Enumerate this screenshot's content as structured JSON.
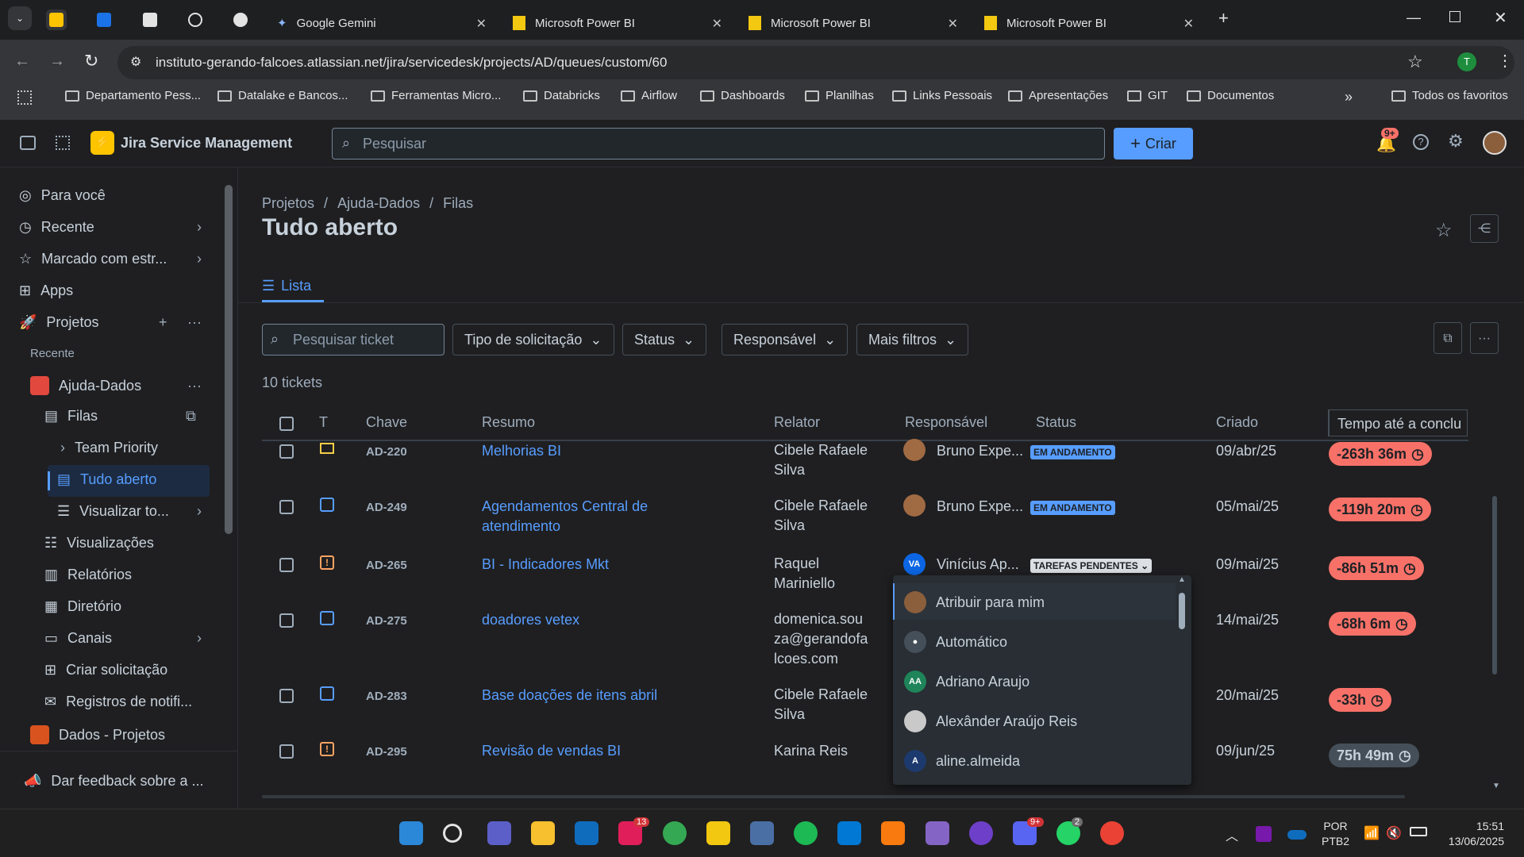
{
  "browser": {
    "tabs": [
      {
        "label": "Google Gemini"
      },
      {
        "label": "Microsoft Power BI"
      },
      {
        "label": "Microsoft Power BI"
      },
      {
        "label": "Microsoft Power BI"
      }
    ],
    "url": "instituto-gerando-falcoes.atlassian.net/jira/servicedesk/projects/AD/queues/custom/60",
    "profile_initial": "T",
    "bookmarks": [
      "Departamento Pess...",
      "Datalake e Bancos...",
      "Ferramentas Micro...",
      "Databricks",
      "Airflow",
      "Dashboards",
      "Planilhas",
      "Links Pessoais",
      "Apresentações",
      "GIT",
      "Documentos"
    ],
    "all_bookmarks": "Todos os favoritos",
    "more_bookmarks": "»"
  },
  "jira": {
    "product": "Jira Service Management",
    "search_placeholder": "Pesquisar",
    "create_label": "Criar",
    "notif_badge": "9+"
  },
  "sidebar": {
    "items": [
      {
        "label": "Para você"
      },
      {
        "label": "Recente"
      },
      {
        "label": "Marcado com estr..."
      },
      {
        "label": "Apps"
      },
      {
        "label": "Projetos"
      }
    ],
    "recent_heading": "Recente",
    "project": "Ajuda-Dados",
    "sub": [
      {
        "label": "Filas"
      },
      {
        "label": "Team Priority"
      },
      {
        "label": "Tudo aberto"
      },
      {
        "label": "Visualizar to..."
      },
      {
        "label": "Visualizações"
      },
      {
        "label": "Relatórios"
      },
      {
        "label": "Diretório"
      },
      {
        "label": "Canais"
      },
      {
        "label": "Criar solicitação"
      },
      {
        "label": "Registros de notifi..."
      }
    ],
    "project2": "Dados - Projetos",
    "feedback": "Dar feedback sobre a ..."
  },
  "page": {
    "breadcrumb": [
      "Projetos",
      "Ajuda-Dados",
      "Filas"
    ],
    "title": "Tudo aberto",
    "tab": "Lista",
    "search_ticket_placeholder": "Pesquisar ticket",
    "filters": [
      "Tipo de solicitação",
      "Status",
      "Responsável",
      "Mais filtros"
    ],
    "count": "10 tickets"
  },
  "table": {
    "headers": [
      "T",
      "Chave",
      "Resumo",
      "Relator",
      "Responsável",
      "Status",
      "Criado",
      "Tempo até a conclu"
    ],
    "rows": [
      {
        "key": "AD-220",
        "summary": "Melhorias BI",
        "reporter": "Cibele Rafaele Silva",
        "assignee": "Bruno Expe...",
        "status": "EM ANDAMENTO",
        "created": "09/abr/25",
        "sla": "-263h 36m"
      },
      {
        "key": "AD-249",
        "summary": "Agendamentos Central de atendimento",
        "reporter": "Cibele Rafaele Silva",
        "assignee": "Bruno Expe...",
        "status": "EM ANDAMENTO",
        "created": "05/mai/25",
        "sla": "-119h 20m"
      },
      {
        "key": "AD-265",
        "summary": "BI - Indicadores Mkt",
        "reporter": "Raquel Mariniello",
        "assignee": "Vinícius Ap...",
        "assignee_initials": "VA",
        "status": "TAREFAS PENDENTES",
        "created": "09/mai/25",
        "sla": "-86h 51m"
      },
      {
        "key": "AD-275",
        "summary": "doadores vetex",
        "reporter": "domenica.souza@gerandofalcoes.com",
        "reporter_lines": [
          "domenica.sou",
          "za@gerandofa",
          "lcoes.com"
        ],
        "created": "14/mai/25",
        "sla": "-68h 6m"
      },
      {
        "key": "AD-283",
        "summary": "Base doações de itens abril",
        "reporter": "Cibele Rafaele Silva",
        "created": "20/mai/25",
        "sla": "-33h"
      },
      {
        "key": "AD-295",
        "summary": "Revisão de vendas BI",
        "reporter": "Karina Reis",
        "created": "09/jun/25",
        "sla": "75h 49m"
      }
    ]
  },
  "assignee_dropdown": {
    "options": [
      {
        "label": "Atribuir para mim"
      },
      {
        "label": "Automático"
      },
      {
        "label": "Adriano Araujo",
        "initials": "AA"
      },
      {
        "label": "Alexânder Araújo Reis"
      },
      {
        "label": "aline.almeida",
        "initials": "A"
      }
    ]
  },
  "taskbar": {
    "lang": "POR",
    "layout": "PTB2",
    "time": "15:51",
    "date": "13/06/2025",
    "badges": {
      "app1": "13",
      "discord": "9+",
      "whatsapp": "2"
    }
  },
  "colors": {
    "accent": "#579dff",
    "sla_overdue": "#f87168",
    "jira_logo": "#ffc400"
  }
}
